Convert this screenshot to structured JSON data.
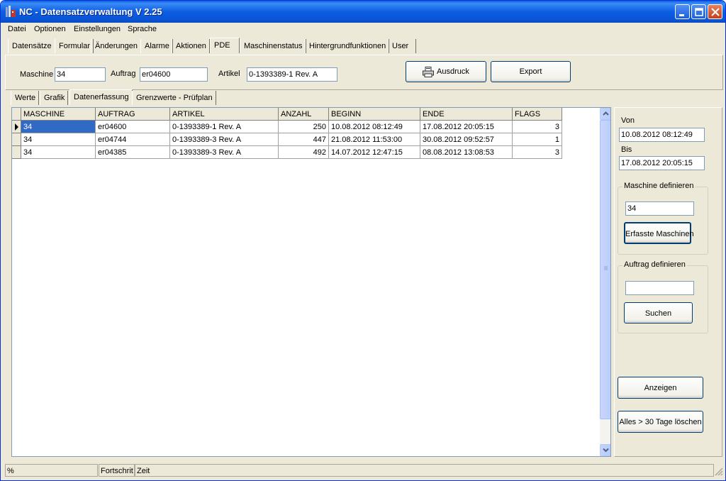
{
  "window": {
    "title": "NC - Datensatzverwaltung V 2.25"
  },
  "menu": [
    "Datei",
    "Optionen",
    "Einstellungen",
    "Sprache"
  ],
  "main_tabs": [
    "Datensätze",
    "Formular",
    "Änderungen",
    "Alarme",
    "Aktionen",
    "PDE",
    "Maschinenstatus",
    "Hintergrundfunktionen",
    "User"
  ],
  "main_tab_active": "PDE",
  "filter": {
    "maschine_label": "Maschine",
    "maschine_value": "34",
    "auftrag_label": "Auftrag",
    "auftrag_value": "er04600",
    "artikel_label": "Artikel",
    "artikel_value": "0-1393389-1 Rev. A",
    "print_label": "Ausdruck",
    "export_label": "Export"
  },
  "sub_tabs": [
    "Werte",
    "Grafik",
    "Datenerfassung",
    "Grenzwerte - Prüfplan"
  ],
  "sub_tab_active": "Datenerfassung",
  "table": {
    "columns": [
      "MASCHINE",
      "AUFTRAG",
      "ARTIKEL",
      "ANZAHL",
      "BEGINN",
      "ENDE",
      "FLAGS"
    ],
    "rows": [
      [
        "34",
        "er04600",
        "0-1393389-1 Rev. A",
        "250",
        "10.08.2012 08:12:49",
        "17.08.2012 20:05:15",
        "3"
      ],
      [
        "34",
        "er04744",
        "0-1393389-3 Rev. A",
        "447",
        "21.08.2012 11:53:00",
        "30.08.2012 09:52:57",
        "1"
      ],
      [
        "34",
        "er04385",
        "0-1393389-3 Rev. A",
        "492",
        "14.07.2012 12:47:15",
        "08.08.2012 13:08:53",
        "3"
      ]
    ]
  },
  "side": {
    "von_label": "Von",
    "von_value": "10.08.2012 08:12:49",
    "bis_label": "Bis",
    "bis_value": "17.08.2012 20:05:15",
    "maschine_group": "Maschine definieren",
    "maschine_value": "34",
    "erfasste_button": "Erfasste Maschinen",
    "auftrag_group": "Auftrag definieren",
    "auftrag_value": "",
    "suchen_button": "Suchen",
    "anzeigen_button": "Anzeigen",
    "loeschen_button": "Alles > 30 Tage löschen"
  },
  "status": {
    "percent": "%",
    "fortschritt": "Fortschrit",
    "zeit": "Zeit"
  },
  "colors": {
    "titlebar": "#0a5ee5",
    "selection": "#316ac5",
    "window_bg": "#ece9d8"
  }
}
